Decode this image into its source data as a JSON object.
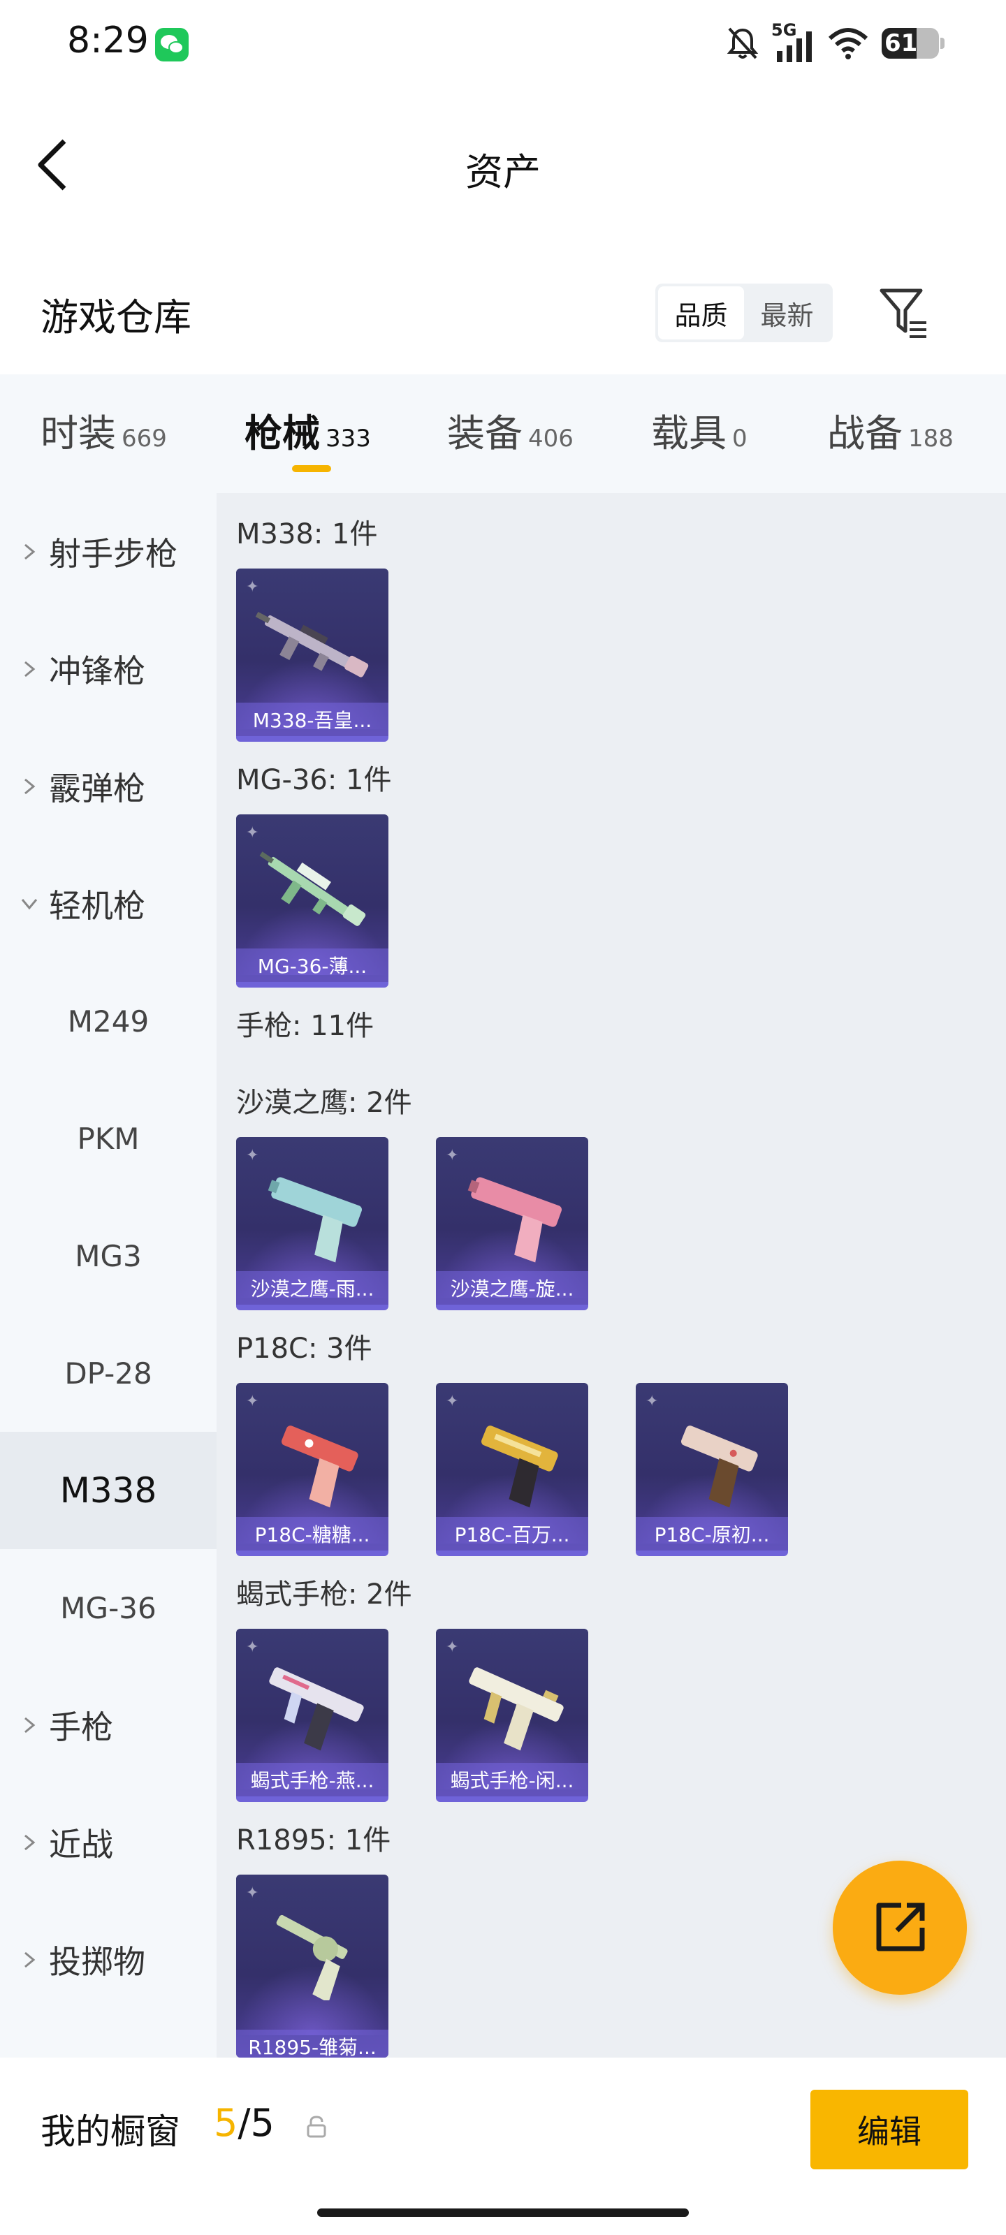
{
  "status_bar": {
    "time": "8:29",
    "network": "5G",
    "battery": "61",
    "battery_level": 0.61
  },
  "nav": {
    "title": "资产"
  },
  "warehouse": {
    "title": "游戏仓库",
    "sort_options": [
      "品质",
      "最新"
    ],
    "active_sort": "品质"
  },
  "tabs": [
    {
      "label": "时装",
      "count": "669"
    },
    {
      "label": "枪械",
      "count": "333"
    },
    {
      "label": "装备",
      "count": "406"
    },
    {
      "label": "载具",
      "count": "0"
    },
    {
      "label": "战备",
      "count": "188"
    }
  ],
  "active_tab": "枪械",
  "sidebar": {
    "categories": [
      {
        "label": "射手步枪",
        "expanded": false
      },
      {
        "label": "冲锋枪",
        "expanded": false
      },
      {
        "label": "霰弹枪",
        "expanded": false
      },
      {
        "label": "轻机枪",
        "expanded": true
      },
      {
        "label": "手枪",
        "expanded": false
      },
      {
        "label": "近战",
        "expanded": false
      },
      {
        "label": "投掷物",
        "expanded": false
      }
    ],
    "subitems": [
      "M249",
      "PKM",
      "MG3",
      "DP-28",
      "M338",
      "MG-36"
    ],
    "active_subitem": "M338"
  },
  "content": {
    "groups": [
      {
        "title": "M338: 1件",
        "items": [
          {
            "name": "M338-吾皇..."
          }
        ]
      },
      {
        "title": "MG-36: 1件",
        "items": [
          {
            "name": "MG-36-薄..."
          }
        ]
      },
      {
        "title": "手枪: 11件",
        "items": []
      },
      {
        "title": "沙漠之鹰: 2件",
        "items": [
          {
            "name": "沙漠之鹰-雨..."
          },
          {
            "name": "沙漠之鹰-旋..."
          }
        ]
      },
      {
        "title": "P18C: 3件",
        "items": [
          {
            "name": "P18C-糖糖..."
          },
          {
            "name": "P18C-百万..."
          },
          {
            "name": "P18C-原初..."
          }
        ]
      },
      {
        "title": "蝎式手枪: 2件",
        "items": [
          {
            "name": "蝎式手枪-燕..."
          },
          {
            "name": "蝎式手枪-闲..."
          }
        ]
      },
      {
        "title": "R1895: 1件",
        "items": [
          {
            "name": "R1895-雏菊..."
          }
        ]
      }
    ]
  },
  "bottom_bar": {
    "label": "我的橱窗",
    "current": "5",
    "separator_total": "/5",
    "edit_label": "编辑"
  },
  "colors": {
    "accent": "#f6b400",
    "card_bg": "#3a3a73",
    "card_border": "#6f63d8"
  }
}
